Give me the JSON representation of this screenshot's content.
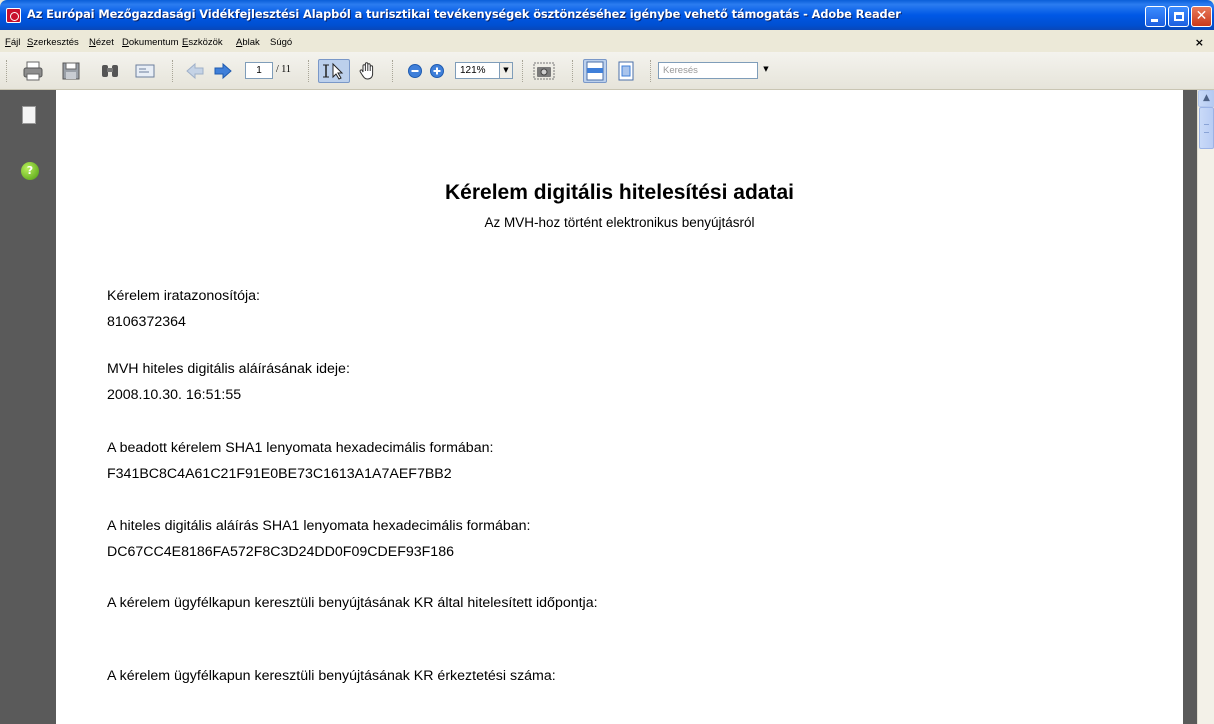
{
  "window": {
    "title": "Az Európai Mezőgazdasági Vidékfejlesztési Alapból a turisztikai tevékenységek ösztönzéséhez igénybe vehető támogatás - Adobe Reader"
  },
  "menu": {
    "file": {
      "u": "F",
      "rest": "ájl"
    },
    "edit": {
      "u": "S",
      "rest": "zerkesztés"
    },
    "view": {
      "u": "N",
      "rest": "ézet"
    },
    "document": {
      "u": "D",
      "rest": "okumentum"
    },
    "tools": {
      "u": "E",
      "rest": "szközök"
    },
    "window": {
      "u": "A",
      "rest": "blak"
    },
    "help": {
      "u": "",
      "rest": "Súgó"
    }
  },
  "toolbar": {
    "current_page": "1",
    "total_pages": "/ 11",
    "zoom": "121%",
    "search_placeholder": "Keresés"
  },
  "document": {
    "title": "Kérelem digitális hitelesítési adatai",
    "subtitle": "Az MVH-hoz történt elektronikus benyújtásról",
    "fields": [
      {
        "label": "Kérelem iratazonosítója:",
        "value": "8106372364"
      },
      {
        "label": "MVH hiteles digitális aláírásának ideje:",
        "value": "2008.10.30. 16:51:55"
      },
      {
        "label": "A beadott kérelem SHA1 lenyomata hexadecimális formában:",
        "value": "F341BC8C4A61C21F91E0BE73C1613A1A7AEF7BB2"
      },
      {
        "label": "A hiteles digitális aláírás SHA1 lenyomata hexadecimális formában:",
        "value": "DC67CC4E8186FA572F8C3D24DD0F09CDEF93F186"
      },
      {
        "label": "A kérelem ügyfélkapun keresztüli benyújtásának KR által hitelesített időpontja:",
        "value": ""
      },
      {
        "label": "A kérelem ügyfélkapun keresztüli benyújtásának KR érkeztetési száma:",
        "value": ""
      }
    ]
  },
  "colors": {
    "titlebar": "#0058e6",
    "chrome": "#ece9d8",
    "nav_background": "#5a5a5a",
    "page": "#ffffff"
  }
}
